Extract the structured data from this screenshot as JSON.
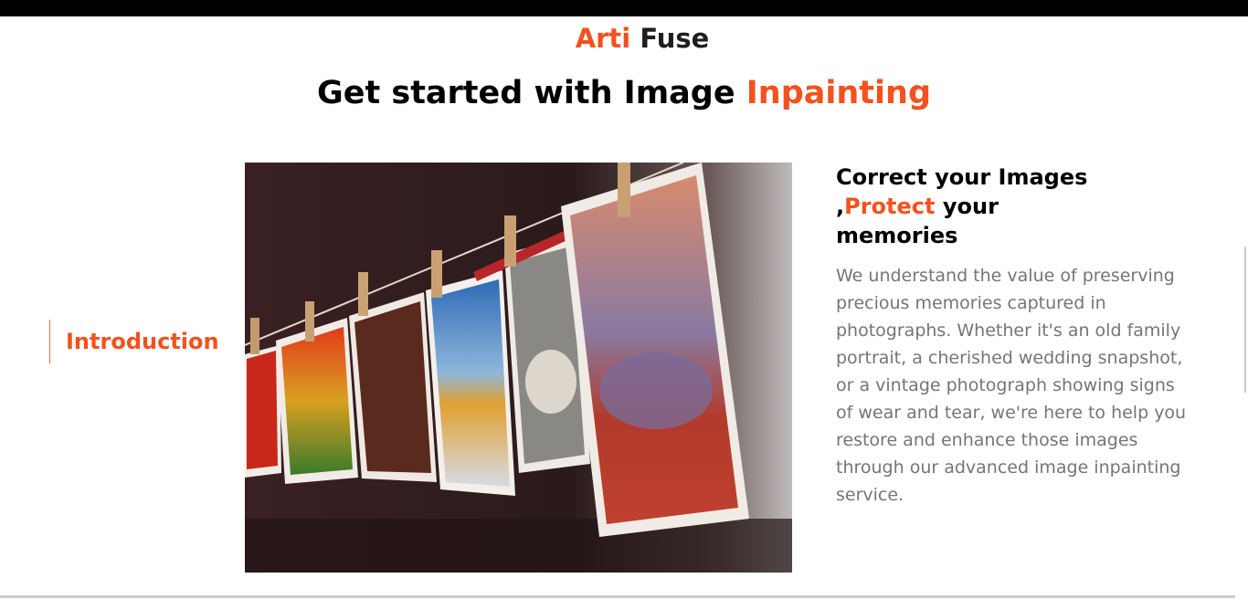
{
  "brand": {
    "name_part1": "Arti",
    "name_part2": "Fuse"
  },
  "headline": {
    "text": "Get started with Image ",
    "accent": "Inpainting"
  },
  "sidebar": {
    "active_tab": "Introduction"
  },
  "content": {
    "title_part1": "Correct your Images ,",
    "title_accent": "Protect",
    "title_part2": " your memories",
    "body": "We understand the value of preserving precious memories captured in photographs. Whether it's an old family portrait, a cherished wedding snapshot, or a vintage photograph showing signs of wear and tear, we're here to help you restore and enhance those images through our advanced image inpainting service."
  },
  "colors": {
    "accent": "#f4511e",
    "text_dark": "#000000",
    "text_muted": "#757575"
  }
}
